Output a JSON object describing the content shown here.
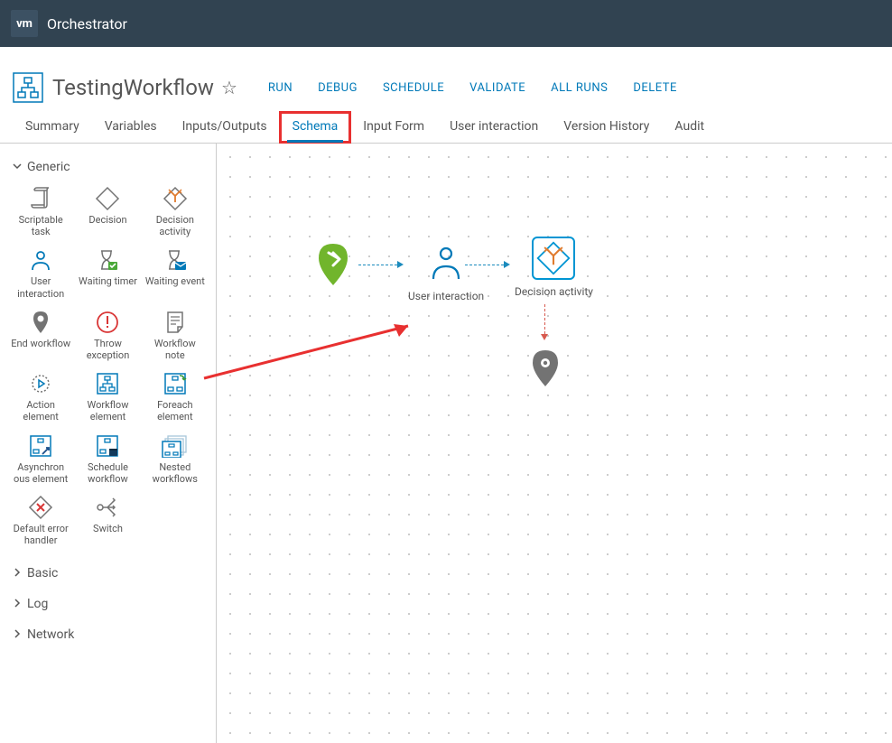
{
  "header": {
    "logo": "vm",
    "title": "Orchestrator"
  },
  "workflow": {
    "name": "TestingWorkflow"
  },
  "actions": [
    "RUN",
    "DEBUG",
    "SCHEDULE",
    "VALIDATE",
    "ALL RUNS",
    "DELETE"
  ],
  "tabs": {
    "items": [
      "Summary",
      "Variables",
      "Inputs/Outputs",
      "Schema",
      "Input Form",
      "User interaction",
      "Version History",
      "Audit"
    ],
    "active_index": 3,
    "highlighted_index": 3
  },
  "sidebar": {
    "categories": [
      {
        "name": "Generic",
        "expanded": true,
        "items": [
          {
            "id": "scriptable-task",
            "label": "Scriptable task"
          },
          {
            "id": "decision",
            "label": "Decision"
          },
          {
            "id": "decision-activity",
            "label": "Decision activity"
          },
          {
            "id": "user-interaction",
            "label": "User interaction"
          },
          {
            "id": "waiting-timer",
            "label": "Waiting timer"
          },
          {
            "id": "waiting-event",
            "label": "Waiting event"
          },
          {
            "id": "end-workflow",
            "label": "End workflow"
          },
          {
            "id": "throw-exception",
            "label": "Throw exception"
          },
          {
            "id": "workflow-note",
            "label": "Workflow note"
          },
          {
            "id": "action-element",
            "label": "Action element"
          },
          {
            "id": "workflow-element",
            "label": "Workflow element"
          },
          {
            "id": "foreach-element",
            "label": "Foreach element"
          },
          {
            "id": "asynchronous-element",
            "label": "Asynchron ous element"
          },
          {
            "id": "schedule-workflow",
            "label": "Schedule workflow"
          },
          {
            "id": "nested-workflows",
            "label": "Nested workflows"
          },
          {
            "id": "default-error-handler",
            "label": "Default error handler"
          },
          {
            "id": "switch",
            "label": "Switch"
          }
        ]
      },
      {
        "name": "Basic",
        "expanded": false
      },
      {
        "name": "Log",
        "expanded": false
      },
      {
        "name": "Network",
        "expanded": false
      }
    ]
  },
  "canvas": {
    "nodes": {
      "start": {
        "label": ""
      },
      "user_interaction": {
        "label": "User interaction"
      },
      "decision_activity": {
        "label": "Decision activity",
        "selected": true
      },
      "end": {
        "label": ""
      }
    }
  },
  "icons": {
    "scriptable-task": "scroll",
    "decision": "diamond",
    "decision-activity": "diamond-branch",
    "user-interaction": "person",
    "waiting-timer": "hourglass-check",
    "waiting-event": "hourglass-mail",
    "end-workflow": "pin",
    "throw-exception": "exclaim",
    "workflow-note": "note",
    "action-element": "gear-play",
    "workflow-element": "flow",
    "foreach-element": "flow-cycle",
    "asynchronous-element": "flow-arrow",
    "schedule-workflow": "flow-cal",
    "nested-workflows": "flow-nested",
    "default-error-handler": "diamond-x",
    "switch": "switch"
  }
}
